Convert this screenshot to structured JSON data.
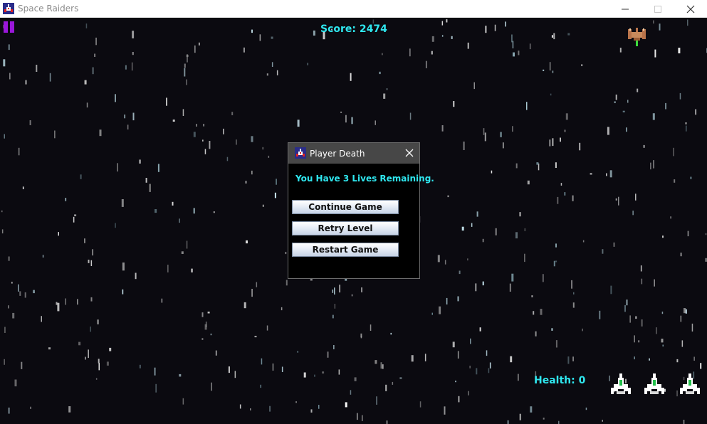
{
  "window": {
    "title": "Space Raiders",
    "icons": {
      "app": "space-raiders-app-icon",
      "minimize": "minimize-icon",
      "maximize": "maximize-icon",
      "close": "close-icon"
    }
  },
  "hud": {
    "score_text": "Score: 2474",
    "health_text": "Health: 0",
    "lives_remaining_shown": 3,
    "colors": {
      "hud_text": "#2fe7ef",
      "pause": "#9a17d9"
    },
    "icons": {
      "pause": "pause-icon",
      "enemy": "enemy-ship-icon",
      "life": "player-ship-icon"
    }
  },
  "dialog": {
    "title": "Player Death",
    "message": "You Have 3 Lives Remaining.",
    "buttons": {
      "continue": "Continue Game",
      "retry": "Retry Level",
      "restart": "Restart Game"
    },
    "icons": {
      "app": "space-raiders-app-icon",
      "close": "close-icon"
    }
  },
  "colors": {
    "background": "#0b0a10",
    "dialog_titlebar": "#474747",
    "dialog_body": "#000000"
  }
}
